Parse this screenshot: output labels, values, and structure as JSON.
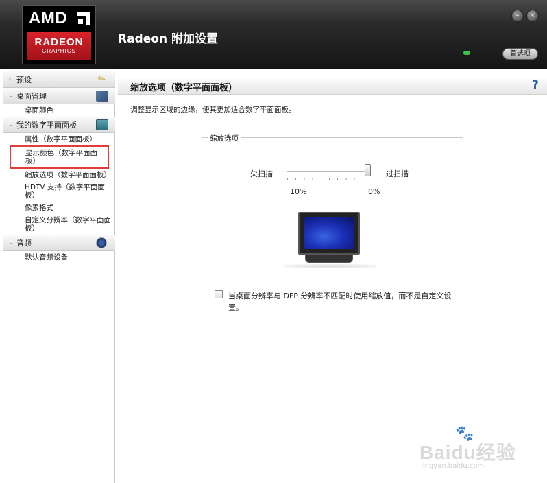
{
  "header": {
    "logo": {
      "brand": "AMD",
      "product": "RADEON",
      "subtitle": "GRAPHICS"
    },
    "title": "Radeon 附加设置",
    "minimize_symbol": "–",
    "close_symbol": "×",
    "preferences_label": "首选项",
    "status_color": "#3fc24d"
  },
  "sidebar": {
    "sections": [
      {
        "label": "预设",
        "icon": "pencil-icon",
        "expanded": false,
        "items": []
      },
      {
        "label": "桌面管理",
        "icon": "desktop-icon",
        "expanded": true,
        "items": [
          "桌面颜色"
        ]
      },
      {
        "label": "我的数字平面面板",
        "icon": "monitor-icon",
        "expanded": true,
        "items": [
          "属性（数字平面面板）",
          "显示颜色（数字平面面板）",
          "缩放选项（数字平面面板）",
          "HDTV 支持（数字平面面板）",
          "像素格式",
          "自定义分辨率（数字平面面板）"
        ]
      },
      {
        "label": "音频",
        "icon": "audio-icon",
        "expanded": true,
        "items": [
          "默认音频设备"
        ]
      }
    ],
    "highlight_color": "#e13d3d"
  },
  "main": {
    "title": "缩放选项（数字平面面板）",
    "help_symbol": "?",
    "description": "调整显示区域的边缘，使其更加适合数字平面面板。",
    "group": {
      "label": "缩放选项",
      "underscan_label": "欠扫描",
      "overscan_label": "过扫描",
      "slider_left_value": "10%",
      "slider_right_value": "0%",
      "slider_fraction": 1.0,
      "checkbox_checked": false,
      "checkbox_label": "当桌面分辨率与 DFP 分辨率不匹配时使用缩放值，而不是自定义设置。"
    }
  },
  "watermark": {
    "text": "Baidu经验",
    "url": "jingyan.baidu.com"
  }
}
